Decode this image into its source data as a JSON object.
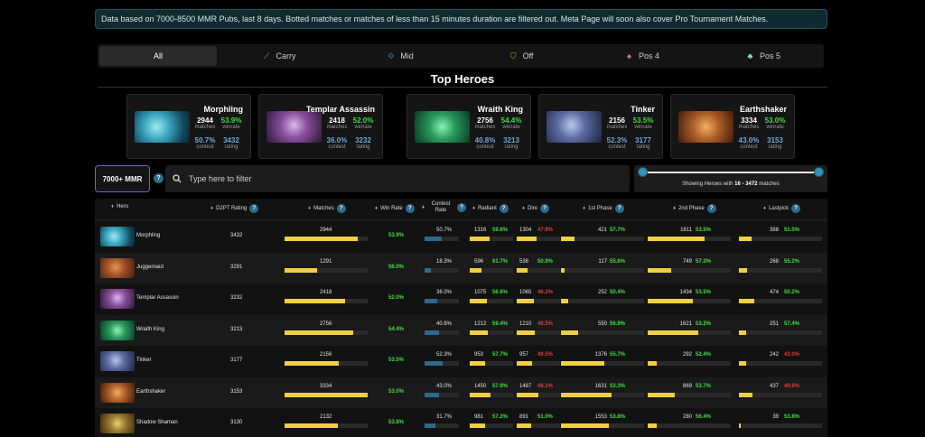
{
  "banner": "Data based on 7000-8500 MMR Pubs, last 8 days. Botted matches or matches of less than 15 minutes duration are filtered out. Meta Page will soon also cover Pro Tournament Matches.",
  "tabs": [
    {
      "label": "All",
      "icon": "",
      "active": true
    },
    {
      "label": "Carry",
      "icon": "carry-icon"
    },
    {
      "label": "Mid",
      "icon": "mid-icon"
    },
    {
      "label": "Off",
      "icon": "off-icon"
    },
    {
      "label": "Pos 4",
      "icon": "pos4-icon"
    },
    {
      "label": "Pos 5",
      "icon": "pos5-icon"
    }
  ],
  "section_title": "Top Heroes",
  "top_heroes": [
    {
      "name": "Morphling",
      "matches": "2944",
      "winrate": "53.9%",
      "contest": "50.7%",
      "rating": "3432"
    },
    {
      "name": "Templar Assassin",
      "matches": "2418",
      "winrate": "52.0%",
      "contest": "36.0%",
      "rating": "3232"
    },
    {
      "name": "Wraith King",
      "matches": "2756",
      "winrate": "54.4%",
      "contest": "40.8%",
      "rating": "3213"
    },
    {
      "name": "Tinker",
      "matches": "2156",
      "winrate": "53.5%",
      "contest": "52.3%",
      "rating": "3177"
    },
    {
      "name": "Earthshaker",
      "matches": "3334",
      "winrate": "53.0%",
      "contest": "43.0%",
      "rating": "3153"
    }
  ],
  "stat_labels": {
    "matches": "matches",
    "winrate": "winrate",
    "contest": "contest",
    "rating": "rating"
  },
  "mmr_button": "7000+ MMR",
  "help_glyph": "?",
  "filter_placeholder": "Type here to filter",
  "range": {
    "prefix": "Showing Heroes with",
    "min": "16",
    "sep": "-",
    "max": "3472",
    "suffix": "matches"
  },
  "columns": {
    "hero": "Hero",
    "rating": "D2PT Rating",
    "matches": "Matches",
    "winrate": "Win Rate",
    "contest": "Contest Rate",
    "radiant": "Radiant",
    "dire": "Dire",
    "phase1": "1st Phase",
    "phase2": "2nd Phase",
    "lastpick": "Lastpick"
  },
  "rows": [
    {
      "hero": "Morphling",
      "rating": "3432",
      "matches": "2944",
      "matches_frac": 0.88,
      "winrate": "53.9%",
      "contest": "50.7%",
      "contest_frac": 0.51,
      "radiant": "1316",
      "radiant_frac": 0.39,
      "radiant_wr": "59.8%",
      "radiant_col": "green",
      "dire": "1304",
      "dire_frac": 0.39,
      "dire_wr": "47.9%",
      "dire_col": "red",
      "p1": "421",
      "p1_frac": 0.16,
      "p1_wr": "57.7%",
      "p1_col": "green",
      "p2": "1811",
      "p2_frac": 0.68,
      "p2_wr": "53.5%",
      "p2_col": "green",
      "lp": "388",
      "lp_frac": 0.15,
      "lp_wr": "51.5%",
      "lp_col": "green"
    },
    {
      "hero": "Juggernaut",
      "rating": "3291",
      "matches": "1291",
      "matches_frac": 0.39,
      "winrate": "56.0%",
      "contest": "18.3%",
      "contest_frac": 0.18,
      "radiant": "596",
      "radiant_frac": 0.18,
      "radiant_wr": "61.7%",
      "radiant_col": "green",
      "dire": "538",
      "dire_frac": 0.16,
      "dire_wr": "50.9%",
      "dire_col": "green",
      "p1": "117",
      "p1_frac": 0.04,
      "p1_wr": "55.6%",
      "p1_col": "green",
      "p2": "749",
      "p2_frac": 0.28,
      "p2_wr": "57.3%",
      "p2_col": "green",
      "lp": "268",
      "lp_frac": 0.1,
      "lp_wr": "55.2%",
      "lp_col": "green"
    },
    {
      "hero": "Templar Assassin",
      "rating": "3232",
      "matches": "2418",
      "matches_frac": 0.73,
      "winrate": "52.0%",
      "contest": "36.0%",
      "contest_frac": 0.36,
      "radiant": "1075",
      "radiant_frac": 0.32,
      "radiant_wr": "56.6%",
      "radiant_col": "green",
      "dire": "1065",
      "dire_frac": 0.32,
      "dire_wr": "46.2%",
      "dire_col": "red",
      "p1": "252",
      "p1_frac": 0.09,
      "p1_wr": "50.4%",
      "p1_col": "green",
      "p2": "1434",
      "p2_frac": 0.54,
      "p2_wr": "53.5%",
      "p2_col": "green",
      "lp": "474",
      "lp_frac": 0.18,
      "lp_wr": "50.2%",
      "lp_col": "green"
    },
    {
      "hero": "Wraith King",
      "rating": "3213",
      "matches": "2756",
      "matches_frac": 0.83,
      "winrate": "54.4%",
      "contest": "40.8%",
      "contest_frac": 0.41,
      "radiant": "1212",
      "radiant_frac": 0.36,
      "radiant_wr": "59.4%",
      "radiant_col": "green",
      "dire": "1210",
      "dire_frac": 0.36,
      "dire_wr": "48.5%",
      "dire_col": "red",
      "p1": "550",
      "p1_frac": 0.21,
      "p1_wr": "56.9%",
      "p1_col": "green",
      "p2": "1621",
      "p2_frac": 0.61,
      "p2_wr": "53.2%",
      "p2_col": "green",
      "lp": "251",
      "lp_frac": 0.09,
      "lp_wr": "57.4%",
      "lp_col": "green"
    },
    {
      "hero": "Tinker",
      "rating": "3177",
      "matches": "2156",
      "matches_frac": 0.65,
      "winrate": "53.5%",
      "contest": "52.3%",
      "contest_frac": 0.52,
      "radiant": "953",
      "radiant_frac": 0.28,
      "radiant_wr": "57.7%",
      "radiant_col": "green",
      "dire": "957",
      "dire_frac": 0.29,
      "dire_wr": "49.5%",
      "dire_col": "red",
      "p1": "1376",
      "p1_frac": 0.52,
      "p1_wr": "55.7%",
      "p1_col": "green",
      "p2": "292",
      "p2_frac": 0.11,
      "p2_wr": "52.4%",
      "p2_col": "green",
      "lp": "242",
      "lp_frac": 0.09,
      "lp_wr": "43.0%",
      "lp_col": "red"
    },
    {
      "hero": "Earthshaker",
      "rating": "3153",
      "matches": "3334",
      "matches_frac": 1.0,
      "winrate": "53.0%",
      "contest": "43.0%",
      "contest_frac": 0.43,
      "radiant": "1450",
      "radiant_frac": 0.43,
      "radiant_wr": "57.9%",
      "radiant_col": "green",
      "dire": "1487",
      "dire_frac": 0.45,
      "dire_wr": "48.1%",
      "dire_col": "red",
      "p1": "1631",
      "p1_frac": 0.61,
      "p1_wr": "53.3%",
      "p1_col": "green",
      "p2": "869",
      "p2_frac": 0.33,
      "p2_wr": "53.7%",
      "p2_col": "green",
      "lp": "437",
      "lp_frac": 0.16,
      "lp_wr": "49.9%",
      "lp_col": "red"
    },
    {
      "hero": "Shadow Shaman",
      "rating": "3130",
      "matches": "2132",
      "matches_frac": 0.64,
      "winrate": "53.8%",
      "contest": "31.7%",
      "contest_frac": 0.32,
      "radiant": "981",
      "radiant_frac": 0.29,
      "radiant_wr": "57.2%",
      "radiant_col": "green",
      "dire": "891",
      "dire_frac": 0.27,
      "dire_wr": "51.0%",
      "dire_col": "green",
      "p1": "1553",
      "p1_frac": 0.58,
      "p1_wr": "53.8%",
      "p1_col": "green",
      "p2": "280",
      "p2_frac": 0.11,
      "p2_wr": "56.4%",
      "p2_col": "green",
      "lp": "39",
      "lp_frac": 0.02,
      "lp_wr": "53.8%",
      "lp_col": "green"
    }
  ]
}
